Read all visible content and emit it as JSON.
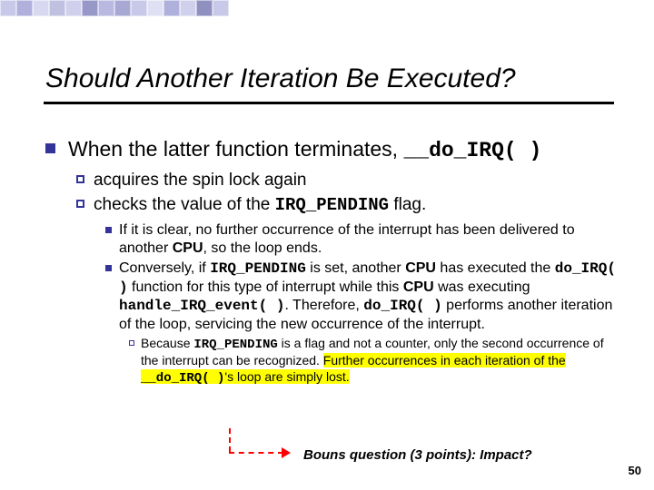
{
  "deco_colors": [
    "#c8c8e8",
    "#b0b0dc",
    "#d8d8f0",
    "#c0c0e0",
    "#d0d0ec",
    "#9898c8",
    "#b8b8e0",
    "#a8a8d4",
    "#c8c8e8",
    "#e0e0f4",
    "#b0b0dc",
    "#d0d0ec",
    "#9090c0",
    "#c8c8e8"
  ],
  "title": "Should Another Iteration Be Executed?",
  "l1_prefix": "When the latter function terminates, ",
  "l1_code": "__do_IRQ( )",
  "l2a": "acquires the spin lock again",
  "l2b_prefix": "checks the value of the ",
  "l2b_code": "IRQ_PENDING",
  "l2b_suffix": " flag.",
  "l3a_p1": "If it is clear, no further occurrence of the interrupt has been delivered to another ",
  "l3a_b1": "CPU",
  "l3a_p2": ", so the loop ends.",
  "l3b_p1": "Conversely, if ",
  "l3b_c1": "IRQ_PENDING",
  "l3b_p2": " is set, another ",
  "l3b_b2": "CPU",
  "l3b_p3": " has executed the ",
  "l3b_c2": "do_IRQ( )",
  "l3b_p4": " function for this type of interrupt while this ",
  "l3b_b3": "CPU",
  "l3b_p5": " was executing ",
  "l3b_c3": "handle_IRQ_event( )",
  "l3b_p6": ". Therefore, ",
  "l3b_c4": "do_IRQ( )",
  "l3b_p7": " performs another iteration of the loop, servicing the new occurrence of the interrupt.",
  "l4_p1": "Because ",
  "l4_c1": "IRQ_PENDING",
  "l4_p2": " is a flag and not a counter, only the second occurrence of the interrupt can be recognized. ",
  "l4_hl_p1": "Further occurrences in each iteration of the ",
  "l4_hl_c1": "__do_IRQ( )",
  "l4_hl_p2": "'s loop are simply lost.",
  "bonus": "Bouns question (3 points): Impact?",
  "page": "50"
}
